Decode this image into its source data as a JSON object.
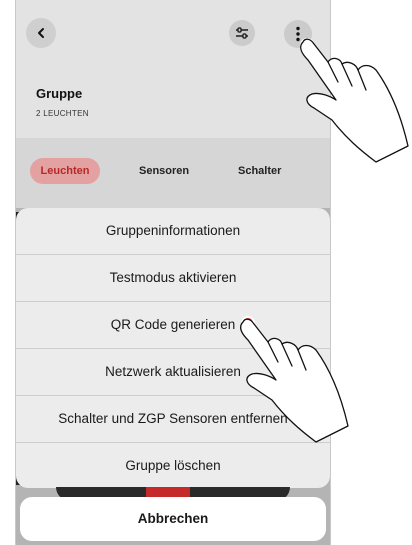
{
  "header": {
    "title": "Gruppe",
    "subtitle": "2 LEUCHTEN"
  },
  "tabs": [
    {
      "label": "Leuchten",
      "active": true
    },
    {
      "label": "Sensoren",
      "active": false
    },
    {
      "label": "Schalter",
      "active": false
    }
  ],
  "menu": {
    "items": [
      {
        "label": "Gruppeninformationen"
      },
      {
        "label": "Testmodus aktivieren"
      },
      {
        "label": "QR Code generieren"
      },
      {
        "label": "Netzwerk aktualisieren"
      },
      {
        "label": "Schalter und ZGP Sensoren entfernen"
      },
      {
        "label": "Gruppe löschen"
      }
    ],
    "cancel_label": "Abbrechen"
  },
  "icons": {
    "back": "chevron-left-icon",
    "filter": "sliders-icon",
    "more": "more-vertical-icon",
    "tap_indicator": "hand-pointer-icon"
  },
  "colors": {
    "accent": "#e1261c",
    "active_tab_bg": "#e3a1a1",
    "active_tab_text": "#b72828"
  }
}
